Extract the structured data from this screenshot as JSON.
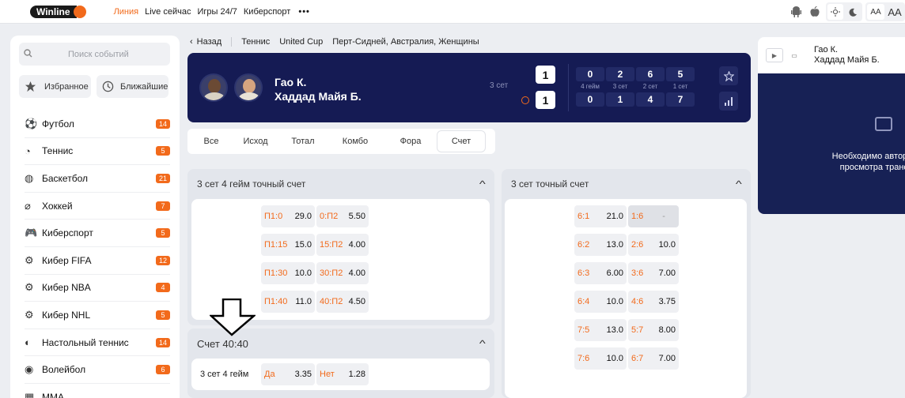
{
  "topbar": {
    "logo": "Winline",
    "nav": [
      "Линия",
      "Live сейчас",
      "Игры 24/7",
      "Киберспорт"
    ],
    "more": "•••",
    "font_small": "AA",
    "font_big": "AA"
  },
  "sidebar": {
    "search_placeholder": "Поиск событий",
    "favorites": "Избранное",
    "upcoming": "Ближайшие",
    "sports": [
      {
        "name": "Футбол",
        "count": "14",
        "icon": "⚽"
      },
      {
        "name": "Теннис",
        "count": "5",
        "icon": "◔"
      },
      {
        "name": "Баскетбол",
        "count": "21",
        "icon": "◍"
      },
      {
        "name": "Хоккей",
        "count": "7",
        "icon": "⌀"
      },
      {
        "name": "Киберспорт",
        "count": "5",
        "icon": "🎮"
      },
      {
        "name": "Кибер FIFA",
        "count": "12",
        "icon": "⚙"
      },
      {
        "name": "Кибер NBA",
        "count": "4",
        "icon": "⚙"
      },
      {
        "name": "Кибер NHL",
        "count": "5",
        "icon": "⚙"
      },
      {
        "name": "Настольный теннис",
        "count": "14",
        "icon": "◐"
      },
      {
        "name": "Волейбол",
        "count": "6",
        "icon": "◉"
      },
      {
        "name": "ММА",
        "count": "",
        "icon": "▦"
      }
    ]
  },
  "breadcrumb": {
    "back": "Назад",
    "items": [
      "Теннис",
      "United Cup",
      "Перт-Сидней, Австралия, Женщины"
    ]
  },
  "match": {
    "player1": "Гао К.",
    "player2": "Хаддад Майя Б.",
    "set_label": "3 сет",
    "sets": [
      "1",
      "1"
    ],
    "score_top": [
      "0",
      "2",
      "6",
      "5"
    ],
    "score_labels": [
      "4 гейм",
      "3 сет",
      "2 сет",
      "1 сет"
    ],
    "score_bottom": [
      "0",
      "1",
      "4",
      "7"
    ]
  },
  "tabs": [
    "Все",
    "Исход",
    "Тотал",
    "Комбо",
    "Фора",
    "Счет"
  ],
  "market1": {
    "title": "3 сет 4 гейм точный счет",
    "left": [
      {
        "label": "П1:0",
        "value": "29.0"
      },
      {
        "label": "П1:15",
        "value": "15.0"
      },
      {
        "label": "П1:30",
        "value": "10.0"
      },
      {
        "label": "П1:40",
        "value": "11.0"
      }
    ],
    "right": [
      {
        "label": "0:П2",
        "value": "5.50"
      },
      {
        "label": "15:П2",
        "value": "4.00"
      },
      {
        "label": "30:П2",
        "value": "4.00"
      },
      {
        "label": "40:П2",
        "value": "4.50"
      }
    ]
  },
  "market2": {
    "title": "Счет 40:40",
    "row_label": "3 сет 4 гейм",
    "yes_label": "Да",
    "yes_value": "3.35",
    "no_label": "Нет",
    "no_value": "1.28"
  },
  "market3": {
    "title": "3 сет точный счет",
    "left": [
      {
        "label": "6:1",
        "value": "21.0"
      },
      {
        "label": "6:2",
        "value": "13.0"
      },
      {
        "label": "6:3",
        "value": "6.00"
      },
      {
        "label": "6:4",
        "value": "10.0"
      },
      {
        "label": "7:5",
        "value": "13.0"
      },
      {
        "label": "7:6",
        "value": "10.0"
      }
    ],
    "right": [
      {
        "label": "1:6",
        "value": "-"
      },
      {
        "label": "2:6",
        "value": "10.0"
      },
      {
        "label": "3:6",
        "value": "7.00"
      },
      {
        "label": "4:6",
        "value": "3.75"
      },
      {
        "label": "5:7",
        "value": "8.00"
      },
      {
        "label": "6:7",
        "value": "7.00"
      }
    ]
  },
  "right_panel": {
    "player1": "Гао К.",
    "player2": "Хаддад Майя Б.",
    "video_message": "Необходимо авторизо просмотра трансл"
  },
  "colors": {
    "accent": "#f26a1b",
    "header_bg": "#151b54"
  }
}
